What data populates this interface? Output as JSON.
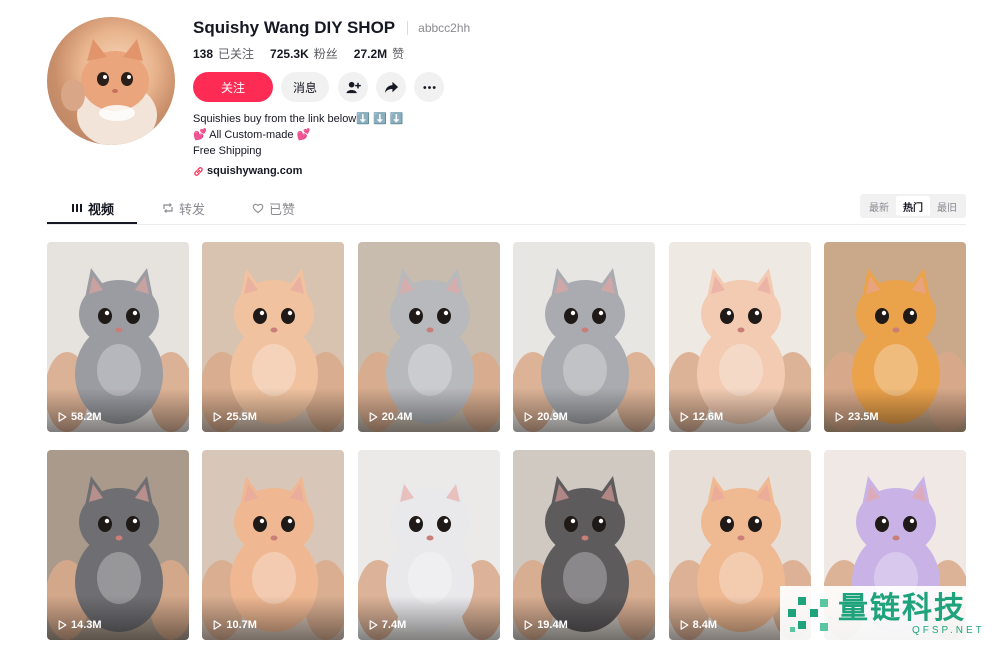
{
  "profile": {
    "name": "Squishy Wang DIY SHOP",
    "handle": "abbcc2hh",
    "stats": [
      {
        "value": "138",
        "label": "已关注"
      },
      {
        "value": "725.3K",
        "label": "粉丝"
      },
      {
        "value": "27.2M",
        "label": "赞"
      }
    ],
    "follow_label": "关注",
    "message_label": "消息",
    "icons": [
      "add-friend-icon",
      "share-icon",
      "more-icon"
    ],
    "bio": [
      "Squishies buy from the link below⬇️ ⬇️ ⬇️",
      "💕 All Custom-made 💕",
      "Free Shipping"
    ],
    "link": "squishywang.com"
  },
  "tabs": [
    {
      "label": "视频",
      "icon": "grid-icon",
      "active": true
    },
    {
      "label": "转发",
      "icon": "repost-icon",
      "active": false
    },
    {
      "label": "已赞",
      "icon": "heart-icon",
      "active": false
    }
  ],
  "sort_options": [
    {
      "label": "最新",
      "active": false
    },
    {
      "label": "热门",
      "active": true
    },
    {
      "label": "最旧",
      "active": false
    }
  ],
  "videos": [
    {
      "views": "58.2M",
      "fur": "#9a9ca2",
      "bg": "#e6e2de"
    },
    {
      "views": "25.5M",
      "fur": "#f0c2a0",
      "bg": "#d8c2b0"
    },
    {
      "views": "20.4M",
      "fur": "#b8b9bd",
      "bg": "#c7bcae"
    },
    {
      "views": "20.9M",
      "fur": "#a9abb0",
      "bg": "#e8e6e3"
    },
    {
      "views": "12.6M",
      "fur": "#f2cbb2",
      "bg": "#efe9e4"
    },
    {
      "views": "23.5M",
      "fur": "#eaa24b",
      "bg": "#c9a98a"
    },
    {
      "views": "14.3M",
      "fur": "#6f6e72",
      "bg": "#a99a8c"
    },
    {
      "views": "10.7M",
      "fur": "#efb893",
      "bg": "#d8c7b8"
    },
    {
      "views": "7.4M",
      "fur": "#e9e9ec",
      "bg": "#ebeae8"
    },
    {
      "views": "19.4M",
      "fur": "#5e5b5d",
      "bg": "#cfc9c2"
    },
    {
      "views": "8.4M",
      "fur": "#efb992",
      "bg": "#e7ded7"
    },
    {
      "views": "",
      "fur": "#c9b3e6",
      "bg": "#efe8e4"
    }
  ],
  "watermark": {
    "title": "量链科技",
    "subtitle": "QFSP.NET"
  },
  "colors": {
    "accent": "#fe2c55",
    "text": "#161823",
    "muted": "#8a8b91",
    "watermark": "#1fa37c"
  }
}
